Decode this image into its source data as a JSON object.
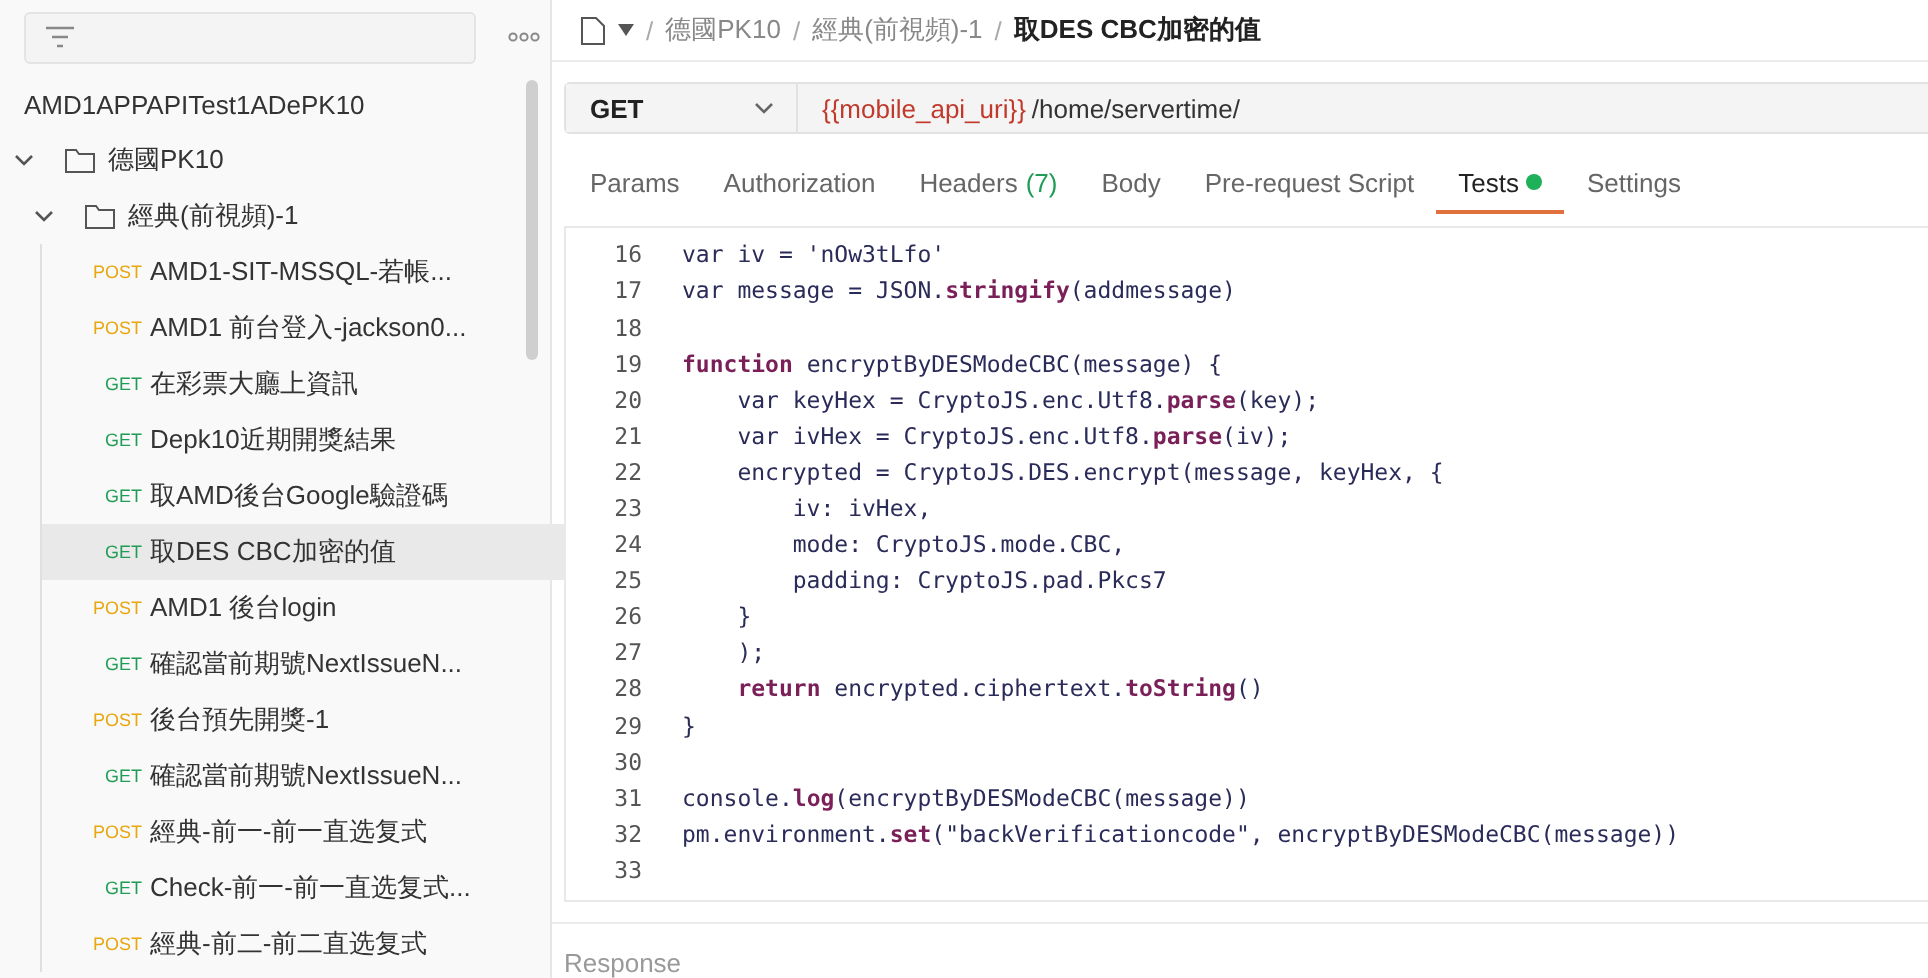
{
  "sidebar": {
    "collection": {
      "name": "AMD1APPAPITest1ADePK10",
      "children": [
        {
          "kind": "folder",
          "name": "德國PK10",
          "expanded": true,
          "children": [
            {
              "kind": "folder",
              "name": "經典(前視頻)-1",
              "expanded": true,
              "children": [
                {
                  "kind": "request",
                  "method": "POST",
                  "color": "#e8a60f",
                  "name": "AMD1-SIT-MSSQL-若帳...",
                  "selected": false
                },
                {
                  "kind": "request",
                  "method": "POST",
                  "color": "#e8a60f",
                  "name": "AMD1 前台登入-jackson0...",
                  "selected": false
                },
                {
                  "kind": "request",
                  "method": "GET",
                  "color": "#1f9d55",
                  "name": "在彩票大廳上資訊",
                  "selected": false
                },
                {
                  "kind": "request",
                  "method": "GET",
                  "color": "#1f9d55",
                  "name": "Depk10近期開獎結果",
                  "selected": false
                },
                {
                  "kind": "request",
                  "method": "GET",
                  "color": "#1f9d55",
                  "name": "取AMD後台Google驗證碼",
                  "selected": false
                },
                {
                  "kind": "request",
                  "method": "GET",
                  "color": "#1f9d55",
                  "name": "取DES CBC加密的值",
                  "selected": true
                },
                {
                  "kind": "request",
                  "method": "POST",
                  "color": "#e8a60f",
                  "name": "AMD1 後台login",
                  "selected": false
                },
                {
                  "kind": "request",
                  "method": "GET",
                  "color": "#1f9d55",
                  "name": "確認當前期號NextIssueN...",
                  "selected": false
                },
                {
                  "kind": "request",
                  "method": "POST",
                  "color": "#e8a60f",
                  "name": "後台預先開獎-1",
                  "selected": false
                },
                {
                  "kind": "request",
                  "method": "GET",
                  "color": "#1f9d55",
                  "name": "確認當前期號NextIssueN...",
                  "selected": false
                },
                {
                  "kind": "request",
                  "method": "POST",
                  "color": "#e8a60f",
                  "name": "經典-前一-前一直选复式",
                  "selected": false
                },
                {
                  "kind": "request",
                  "method": "GET",
                  "color": "#1f9d55",
                  "name": "Check-前一-前一直选复式...",
                  "selected": false
                },
                {
                  "kind": "request",
                  "method": "POST",
                  "color": "#e8a60f",
                  "name": "經典-前二-前二直选复式",
                  "selected": false
                }
              ]
            }
          ]
        }
      ]
    }
  },
  "breadcrumb": [
    {
      "separator": "/",
      "label": "德國PK10"
    },
    {
      "separator": "/",
      "label": "經典(前視頻)-1"
    },
    {
      "separator": "/",
      "label": "取DES CBC加密的值"
    }
  ],
  "request": {
    "method": "GET",
    "url_variable": "{{mobile_api_uri}}",
    "url_path": "/home/servertime/"
  },
  "tabs": [
    {
      "label": "Params",
      "selected": false
    },
    {
      "label": "Authorization",
      "selected": false
    },
    {
      "label": "Headers",
      "count": "(7)",
      "selected": false
    },
    {
      "label": "Body",
      "selected": false
    },
    {
      "label": "Pre-request Script",
      "selected": false
    },
    {
      "label": "Tests",
      "selected": true,
      "has_content": true
    },
    {
      "label": "Settings",
      "selected": false
    }
  ],
  "code_lines": [
    {
      "number": "16",
      "text": "var iv = 'nOw3tLfo'"
    },
    {
      "number": "17",
      "text": "var message = JSON.**stringify**(addmessage)"
    },
    {
      "number": "18"
    },
    {
      "number": "19",
      "text": "**function** encryptByDESModeCBC(message) {"
    },
    {
      "number": "20",
      "text": "    var keyHex = CryptoJS.enc.Utf8.**parse**(key);"
    },
    {
      "number": "21",
      "text": "    var ivHex = CryptoJS.enc.Utf8.**parse**(iv);"
    },
    {
      "number": "22",
      "text": "    encrypted = CryptoJS.DES.encrypt(message, keyHex, {"
    },
    {
      "number": "23",
      "text": "        iv: ivHex,"
    },
    {
      "number": "24",
      "text": "        mode: CryptoJS.mode.CBC,"
    },
    {
      "number": "25",
      "text": "        padding: CryptoJS.pad.Pkcs7"
    },
    {
      "number": "26",
      "text": "    }"
    },
    {
      "number": "27",
      "text": "    );"
    },
    {
      "number": "28",
      "text": "    **return** encrypted.ciphertext.**toString**()"
    },
    {
      "number": "29",
      "text": "}"
    },
    {
      "number": "30"
    },
    {
      "number": "31",
      "text": "console.**log**(encryptByDESModeCBC(message))"
    },
    {
      "number": "32",
      "text": "pm.environment.**set**(\"backVerificationcode\", encryptByDESModeCBC(message))"
    },
    {
      "number": "33"
    }
  ],
  "response": {
    "label": "Response"
  }
}
